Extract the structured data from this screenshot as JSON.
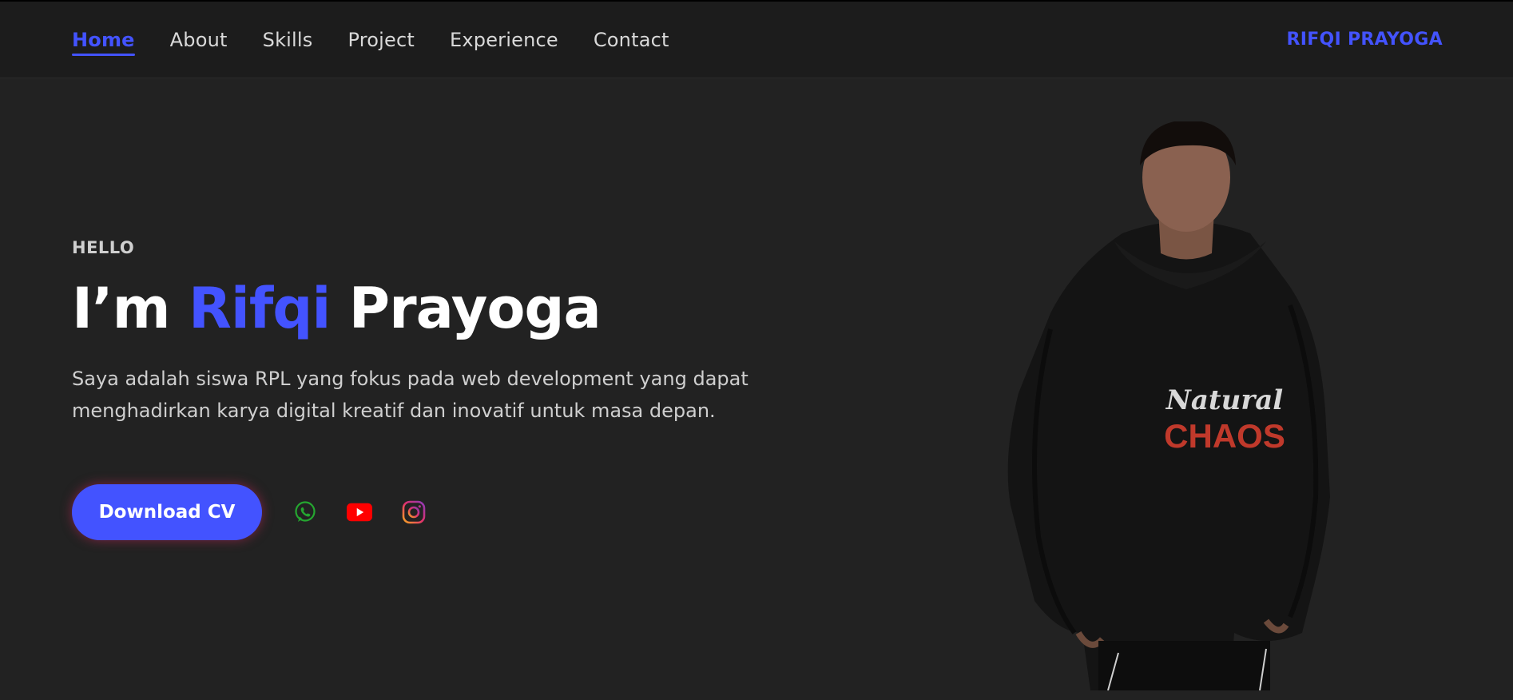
{
  "nav": {
    "links": [
      "Home",
      "About",
      "Skills",
      "Project",
      "Experience",
      "Contact"
    ],
    "active": "Home",
    "brand": "RIFQI PRAYOGA"
  },
  "hero": {
    "greeting": "HELLO",
    "headline_prefix": "I’m",
    "headline_accent": "Rifqi",
    "headline_suffix": "Prayoga",
    "description": "Saya adalah siswa RPL yang fokus pada web development yang dapat menghadirkan karya digital kreatif dan inovatif untuk masa depan.",
    "cta_label": "Download CV",
    "social": [
      "whatsapp-icon",
      "youtube-icon",
      "instagram-icon"
    ],
    "photo_print_line1": "Natural",
    "photo_print_line2": "CHAOS"
  },
  "colors": {
    "background": "#222222",
    "navbar": "#1c1c1c",
    "accent": "#4353ff",
    "whatsapp": "#25a630",
    "youtube": "#ff0000"
  }
}
